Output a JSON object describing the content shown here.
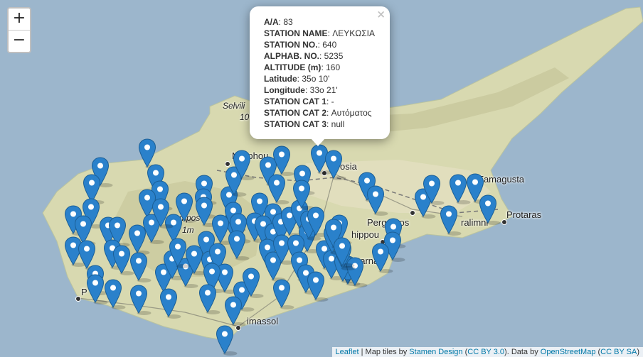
{
  "zoom": {
    "in": "+",
    "out": "−"
  },
  "popup": {
    "close": "×",
    "rows": [
      {
        "k": "A/A",
        "v": "83"
      },
      {
        "k": "STATION NAME",
        "v": "ΛΕΥΚΩΣΙΑ"
      },
      {
        "k": "STATION NO.",
        "v": "640"
      },
      {
        "k": "ALPHAB. NO.",
        "v": "5235"
      },
      {
        "k": "ALTITUDE (m)",
        "v": "160"
      },
      {
        "k": "Latitude",
        "v": "35o 10'"
      },
      {
        "k": "Longitude",
        "v": "33o 21'"
      },
      {
        "k": "STATION CAT 1",
        "v": "-"
      },
      {
        "k": "STATION CAT 2",
        "v": "Αυτόματος"
      },
      {
        "k": "STATION CAT 3",
        "v": "null"
      }
    ]
  },
  "places": {
    "selvili": "Selvili",
    "selvili_alt": "10",
    "morphou": "Morphou",
    "nicosia": "osia",
    "famagusta": "Famagusta",
    "protaras": "Protaras",
    "pergamos": "Pergamos",
    "paralimni": "ralimni",
    "dhippou": "hippou",
    "larnaca": "Larna",
    "limassol": "imassol",
    "paphos": "P",
    "olympos": "ympos",
    "olympos_alt": "1m"
  },
  "attribution": {
    "leaflet": "Leaflet",
    "sep1": " | Map tiles by ",
    "stamen": "Stamen Design",
    "cc30": "CC BY 3.0",
    "data": ". Data by ",
    "osm": "OpenStreetMap",
    "ccsa": "CC BY SA"
  },
  "colors": {
    "marker": "#2a81cb",
    "sea": "#9cb6cc",
    "land": "#d8d9b0"
  }
}
